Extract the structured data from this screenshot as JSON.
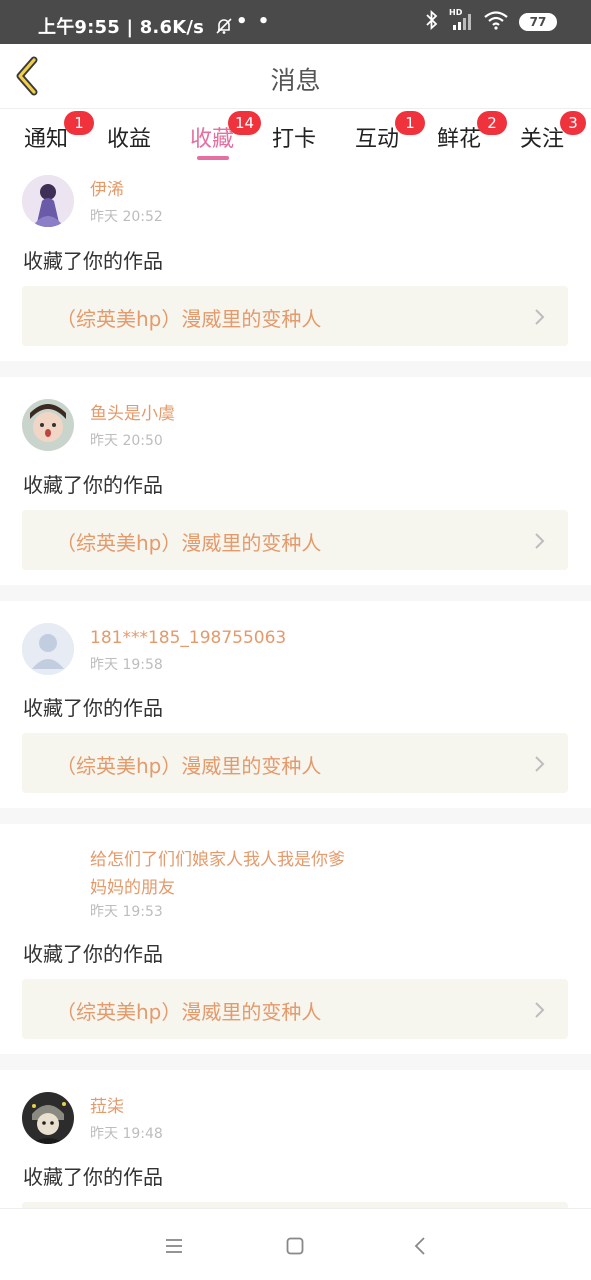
{
  "status_bar": {
    "time": "上午9:55",
    "speed": "8.6K/s",
    "dots": "• •",
    "battery": "77",
    "hd_label": "HD"
  },
  "header": {
    "title": "消息",
    "back_icon": "chevron-left-icon"
  },
  "tabs": [
    {
      "label": "通知",
      "badge": "1"
    },
    {
      "label": "收益",
      "badge": ""
    },
    {
      "label": "收藏",
      "badge": "14",
      "active": true
    },
    {
      "label": "打卡",
      "badge": ""
    },
    {
      "label": "互动",
      "badge": "1"
    },
    {
      "label": "鲜花",
      "badge": "2"
    },
    {
      "label": "关注",
      "badge": "3"
    }
  ],
  "items": [
    {
      "name": "伊浠",
      "time": "昨天 20:52",
      "action": "收藏了你的作品",
      "work": "（综英美hp）漫威里的变种人"
    },
    {
      "name": "鱼头是小虞",
      "time": "昨天 20:50",
      "action": "收藏了你的作品",
      "work": "（综英美hp）漫威里的变种人"
    },
    {
      "name": "181***185_198755063",
      "time": "昨天 19:58",
      "action": "收藏了你的作品",
      "work": "（综英美hp）漫威里的变种人"
    },
    {
      "name_line1": "给怎们了们们娘家人我人我是你爹",
      "name_line2": "妈妈的朋友",
      "time": "昨天 19:53",
      "action": "收藏了你的作品",
      "work": "（综英美hp）漫威里的变种人"
    },
    {
      "name": "菈柒",
      "time": "昨天 19:48",
      "action": "收藏了你的作品"
    }
  ],
  "colors": {
    "accent": "#e46fa0",
    "badge": "#f0323d",
    "username": "#e49a6b",
    "work_bg": "#f6f5ee"
  }
}
